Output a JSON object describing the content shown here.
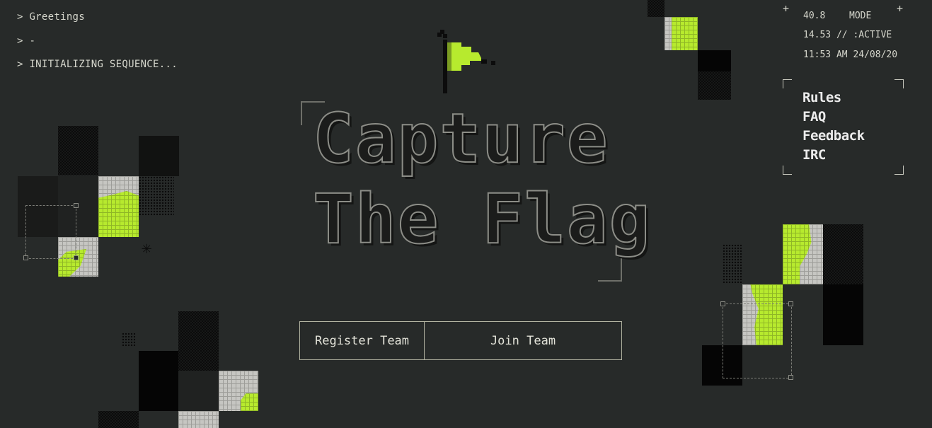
{
  "terminal": {
    "lines": [
      "> Greetings",
      "> -",
      "> INITIALIZING SEQUENCE..."
    ]
  },
  "status": {
    "value1": "40.8",
    "mode": "MODE",
    "line2": "14.53 // :ACTIVE",
    "datetime": "11:53 AM 24/08/20",
    "plus": "+"
  },
  "nav": {
    "items": [
      "Rules",
      "FAQ",
      "Feedback",
      "IRC"
    ]
  },
  "title": {
    "line1": "Capture",
    "line2": "The Flag"
  },
  "buttons": {
    "register": "Register Team",
    "join": "Join Team"
  },
  "colors": {
    "background": "#272a29",
    "accent": "#b7ea2e",
    "text": "#d5d6cc"
  },
  "icons": {
    "flag": "pixel-flag-icon",
    "sparkle": "asterisk-icon"
  }
}
